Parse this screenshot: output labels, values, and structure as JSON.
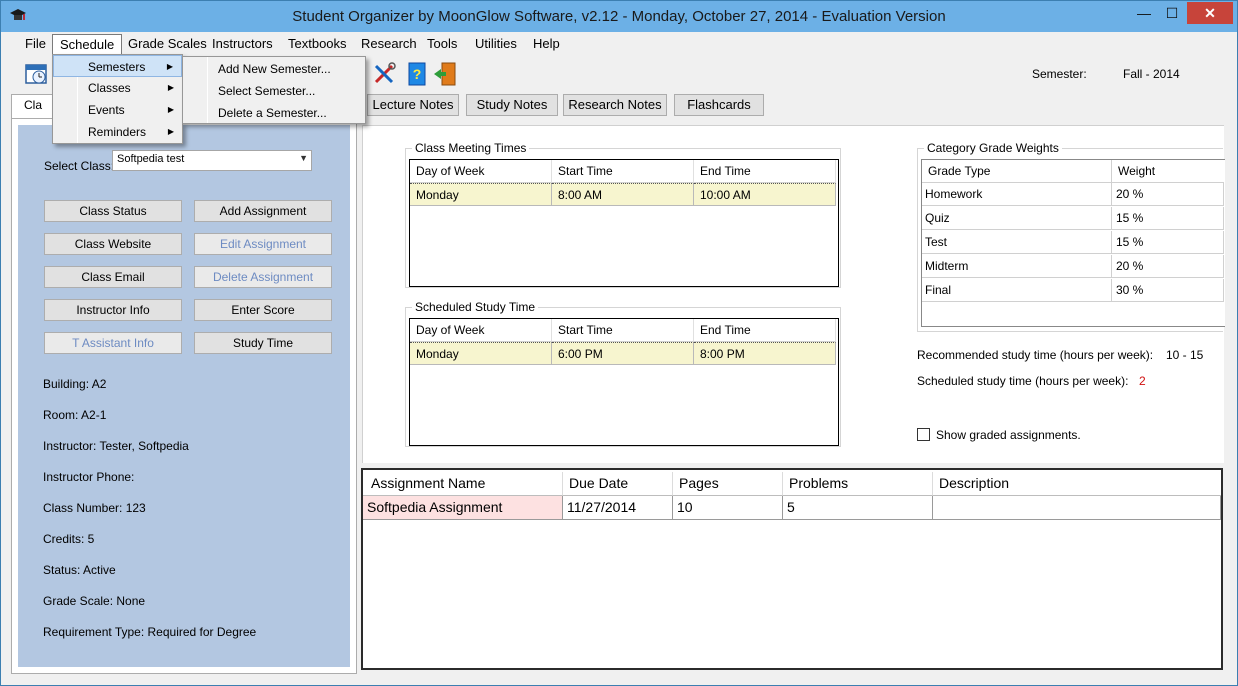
{
  "window": {
    "title": "Student Organizer by MoonGlow Software, v2.12  -  Monday, October 27, 2014  -  Evaluation Version",
    "minimize": "—",
    "maximize": "☐",
    "close": "✕"
  },
  "menubar": [
    "File",
    "Schedule",
    "Grade Scales",
    "Instructors",
    "Textbooks",
    "Research",
    "Tools",
    "Utilities",
    "Help"
  ],
  "toolbar": {
    "semester_label": "Semester:",
    "semester_value": "Fall - 2014",
    "icons": [
      "calendar-clock-icon",
      "tools-icon",
      "help-book-icon",
      "exit-door-icon"
    ]
  },
  "tabs": {
    "class_tab": "Cla",
    "notes": [
      "Lecture Notes",
      "Study Notes",
      "Research Notes",
      "Flashcards"
    ]
  },
  "schedule_menu": {
    "items": [
      "Semesters",
      "Classes",
      "Events",
      "Reminders"
    ],
    "semesters_submenu": [
      "Add New Semester...",
      "Select Semester...",
      "Delete a Semester..."
    ]
  },
  "left_panel": {
    "select_label": "Select Class:",
    "select_value": "Softpedia test",
    "buttons": {
      "class_status": "Class Status",
      "add_assignment": "Add Assignment",
      "class_website": "Class Website",
      "edit_assignment": "Edit Assignment",
      "class_email": "Class Email",
      "delete_assignment": "Delete Assignment",
      "instructor_info": "Instructor Info",
      "enter_score": "Enter Score",
      "ta_info": "T Assistant Info",
      "study_time": "Study Time"
    },
    "info": [
      "Building:  A2",
      "Room:  A2-1",
      "Instructor:  Tester,  Softpedia",
      "Instructor Phone:",
      "Class Number:  123",
      "Credits:  5",
      "Status:  Active",
      "Grade Scale:  None",
      "Requirement Type:  Required for Degree"
    ]
  },
  "class_meeting": {
    "title": "Class Meeting Times",
    "columns": [
      "Day of Week",
      "Start Time",
      "End Time"
    ],
    "rows": [
      [
        "Monday",
        "8:00 AM",
        "10:00 AM"
      ]
    ]
  },
  "study_schedule": {
    "title": "Scheduled Study Time",
    "columns": [
      "Day of Week",
      "Start Time",
      "End Time"
    ],
    "rows": [
      [
        "Monday",
        "6:00 PM",
        "8:00 PM"
      ]
    ]
  },
  "grade_weights": {
    "title": "Category Grade Weights",
    "columns": [
      "Grade Type",
      "Weight"
    ],
    "rows": [
      [
        "Homework",
        "20 %"
      ],
      [
        "Quiz",
        "15 %"
      ],
      [
        "Test",
        "15 %"
      ],
      [
        "Midterm",
        "20 %"
      ],
      [
        "Final",
        "30 %"
      ]
    ]
  },
  "study_stats": {
    "recommended_label": "Recommended study time (hours per week):",
    "recommended_value": "10 - 15",
    "scheduled_label": "Scheduled study time (hours per week):",
    "scheduled_value": "2",
    "scheduled_color": "#d01010",
    "show_graded": "Show graded assignments."
  },
  "assignments": {
    "columns": [
      "Assignment Name",
      "Due Date",
      "Pages",
      "Problems",
      "Description"
    ],
    "rows": [
      [
        "Softpedia Assignment",
        "11/27/2014",
        "10",
        "5",
        ""
      ]
    ],
    "highlight_color": "#fde1e1"
  }
}
